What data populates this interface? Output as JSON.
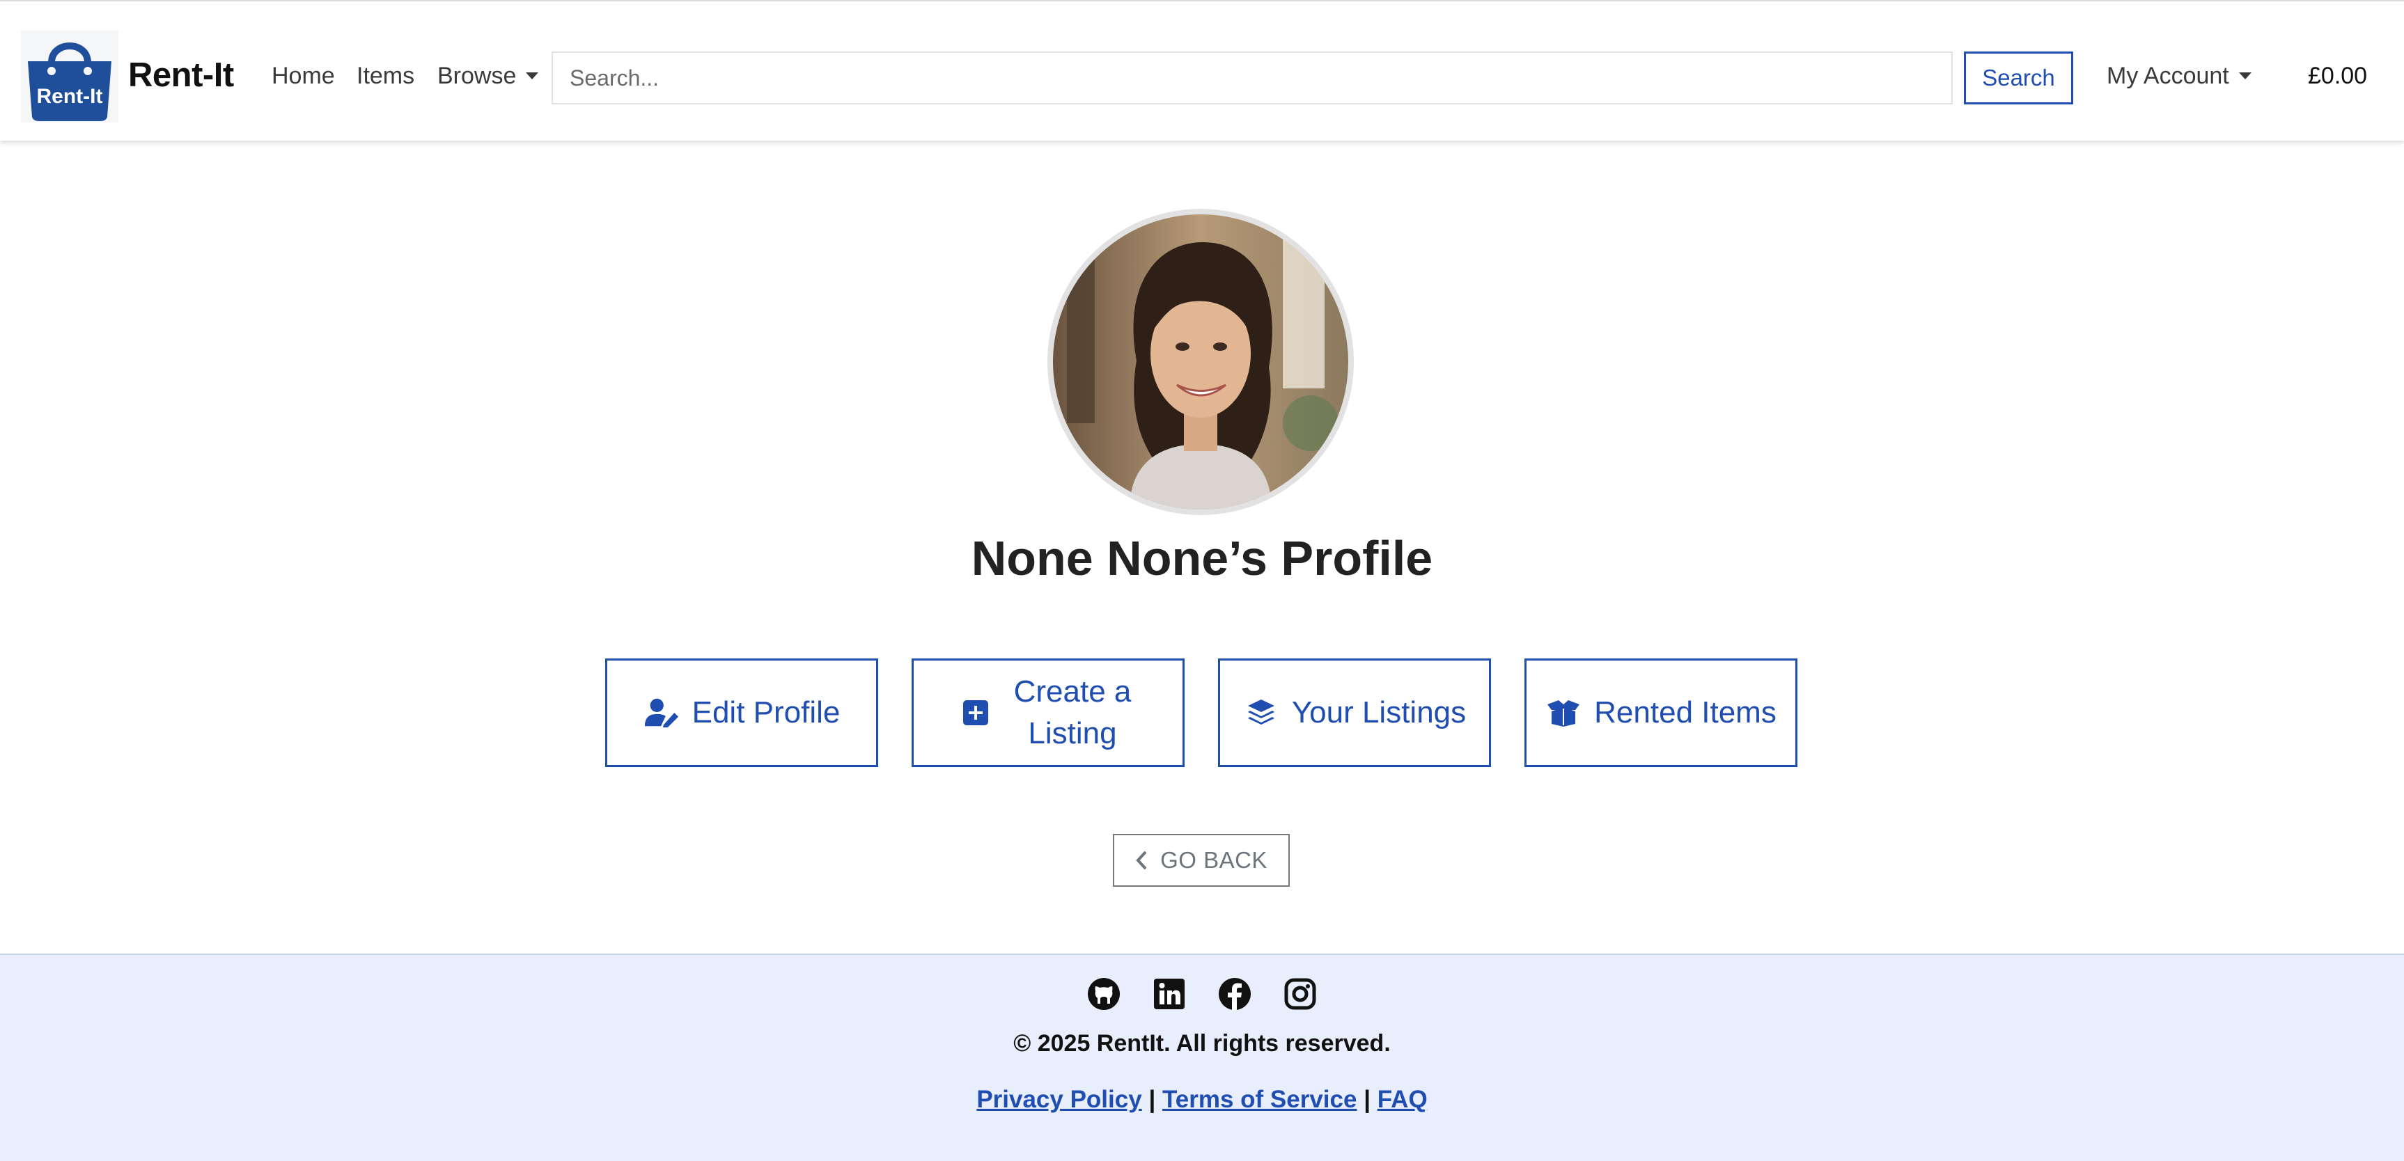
{
  "header": {
    "logo_text": "Rent-It",
    "brand": "Rent-It",
    "nav": {
      "home": "Home",
      "items": "Items",
      "browse": "Browse"
    },
    "search": {
      "placeholder": "Search...",
      "button": "Search"
    },
    "account": "My Account",
    "cart_total": "£0.00"
  },
  "profile": {
    "title": "None None’s Profile",
    "actions": [
      {
        "label": "Edit Profile",
        "icon": "user-pen-icon"
      },
      {
        "label": "Create a Listing",
        "icon": "plus-square-icon"
      },
      {
        "label": "Your Listings",
        "icon": "layer-group-icon"
      },
      {
        "label": "Rented Items",
        "icon": "box-open-icon"
      }
    ],
    "back": "GO BACK"
  },
  "footer": {
    "social": [
      "github-icon",
      "linkedin-icon",
      "facebook-icon",
      "instagram-icon"
    ],
    "copyright": "© 2025 RentIt. All rights reserved.",
    "links": {
      "privacy": "Privacy Policy",
      "terms": "Terms of Service",
      "faq": "FAQ",
      "separator": "|"
    }
  },
  "colors": {
    "accent": "#1f4db0",
    "footer_bg": "#e8eefc",
    "logo": "#1f4f9a"
  }
}
